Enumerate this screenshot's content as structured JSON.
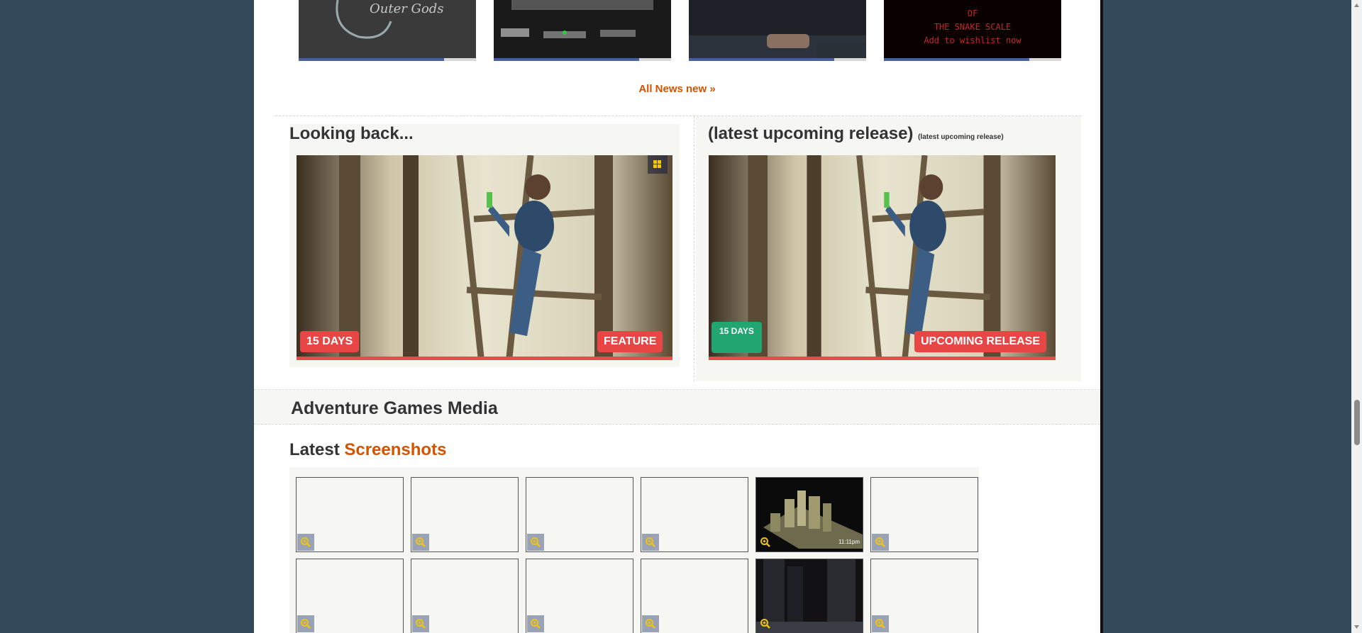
{
  "news": {
    "thumbs": [
      {
        "name": "news-thumb-1",
        "caption": "Outer Gods",
        "progress": 0.82
      },
      {
        "name": "news-thumb-2",
        "caption": "",
        "progress": 0.82
      },
      {
        "name": "news-thumb-3",
        "caption": "",
        "progress": 0.82
      },
      {
        "name": "news-thumb-4",
        "caption_lines": [
          "OF",
          "THE SNAKE SCALE",
          "Add to wishlist now"
        ],
        "progress": 0.82
      }
    ],
    "all_news_link": "All News new »"
  },
  "looking_back": {
    "title": "Looking back...",
    "days_badge": "15 DAYS",
    "type_badge": "FEATURE",
    "platform_icon": "windows-icon"
  },
  "upcoming": {
    "title": "(latest upcoming release)",
    "subtitle": "(latest upcoming release)",
    "days_badge": "15 DAYS",
    "type_badge": "UPCOMING RELEASE"
  },
  "media": {
    "title": "Adventure Games Media"
  },
  "screenshots": {
    "title_prefix": "Latest",
    "title_accent": "Screenshots",
    "row1_caption": "11:11pm",
    "zoom_icon": "zoom-in-icon"
  },
  "colors": {
    "accent": "#d35400",
    "badge_red": "#e84545",
    "badge_green": "#21a672",
    "page_bg": "#34495a"
  }
}
